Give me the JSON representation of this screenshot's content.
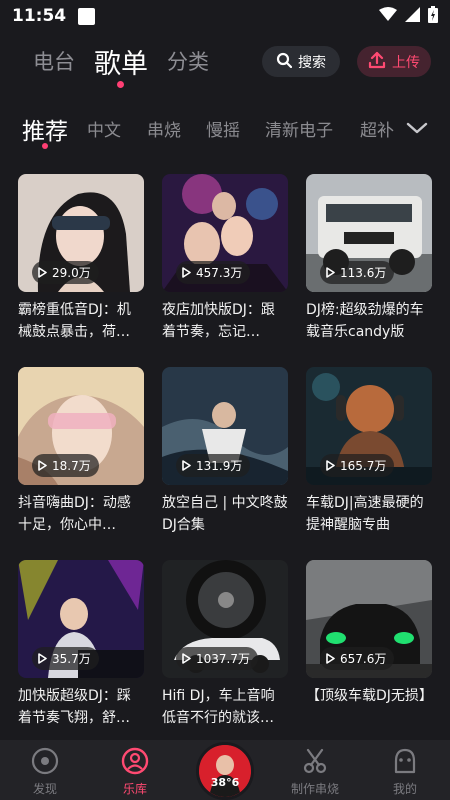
{
  "status": {
    "time": "11:54"
  },
  "top_tabs": [
    "电台",
    "歌单",
    "分类"
  ],
  "search_label": "搜索",
  "upload_label": "上传",
  "categories": [
    "推荐",
    "中文",
    "串烧",
    "慢摇",
    "清新电子",
    "超补"
  ],
  "playlists": [
    {
      "plays": "29.0万",
      "title": "霸榜重低音DJ：机械鼓点暴击，荷…"
    },
    {
      "plays": "457.3万",
      "title": "夜店加快版DJ：跟着节奏，忘记…"
    },
    {
      "plays": "113.6万",
      "title": "DJ榜:超级劲爆的车载音乐candy版"
    },
    {
      "plays": "18.7万",
      "title": "抖音嗨曲DJ：动感十足，你心中…"
    },
    {
      "plays": "131.9万",
      "title": "放空自己 | 中文咚鼓DJ合集"
    },
    {
      "plays": "165.7万",
      "title": "车载DJ|高速最硬的提神醒脑专曲"
    },
    {
      "plays": "35.7万",
      "title": "加快版超级DJ：踩着节奏飞翔，舒…"
    },
    {
      "plays": "1037.7万",
      "title": "Hifi DJ，车上音响低音不行的就该…"
    },
    {
      "plays": "657.6万",
      "title": "【顶级车载DJ无损】"
    }
  ],
  "bottom_nav": [
    "发现",
    "乐库",
    "制作串烧",
    "我的"
  ],
  "center_disc_text": "38°6",
  "colors": {
    "accent": "#ff3f74",
    "background": "#1a1a1e"
  }
}
